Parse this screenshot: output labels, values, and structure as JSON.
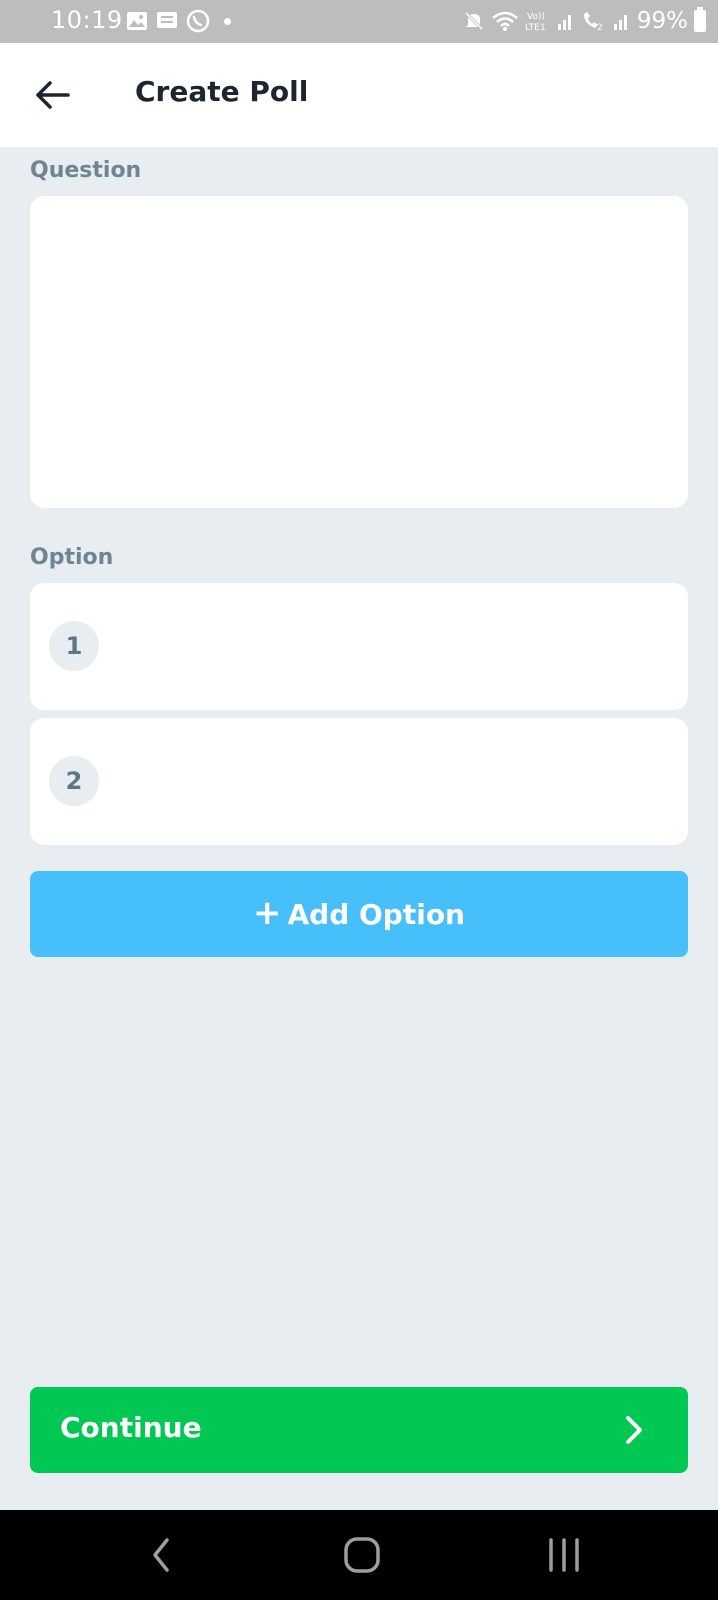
{
  "status_bar": {
    "time": "10:19",
    "battery": "99%",
    "icons": [
      "gallery-icon",
      "message-icon",
      "whatsapp-icon",
      "notification-dot",
      "mute-icon",
      "wifi-icon",
      "volte-lte-icon",
      "signal-icon",
      "wifi-calling-icon",
      "signal-icon",
      "battery-icon"
    ]
  },
  "header": {
    "title": "Create Poll",
    "back_icon": "arrow-left-icon"
  },
  "question": {
    "label": "Question",
    "value": ""
  },
  "options": {
    "label": "Option",
    "items": [
      {
        "number": "1",
        "value": ""
      },
      {
        "number": "2",
        "value": ""
      }
    ]
  },
  "add_option": {
    "label": "Add Option",
    "icon": "plus-icon",
    "color": "#47bffb"
  },
  "continue_button": {
    "label": "Continue",
    "icon": "chevron-right-icon",
    "color": "#00c853"
  },
  "nav_bar": {
    "buttons": [
      "back-nav-icon",
      "home-nav-icon",
      "recents-nav-icon"
    ]
  }
}
